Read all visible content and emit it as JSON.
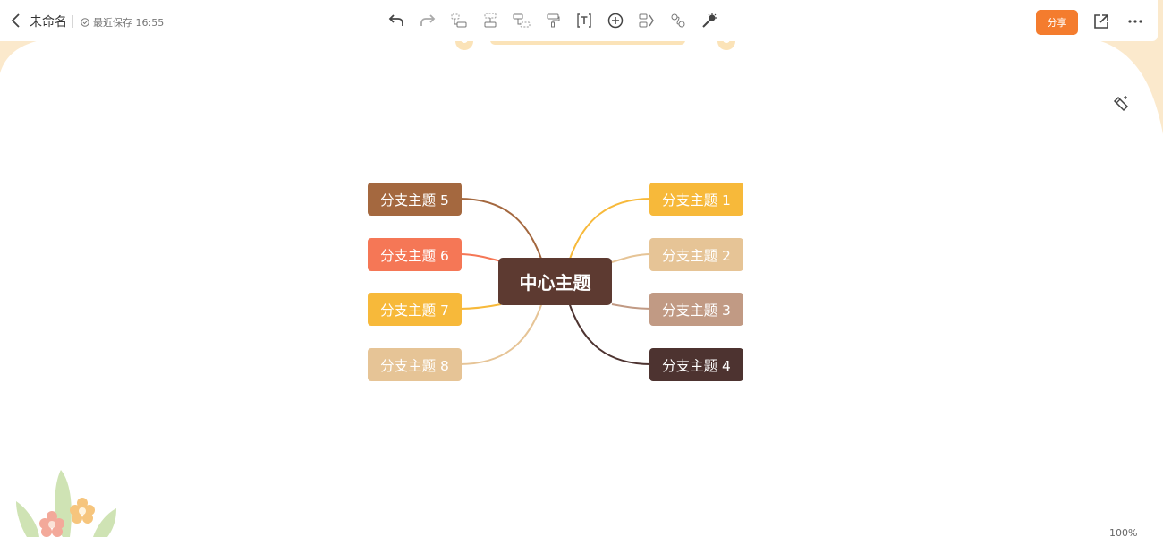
{
  "header": {
    "back_icon": "chevron-left-icon",
    "title": "未命名",
    "save_status": "最近保存 16:55",
    "share_label": "分享",
    "share_color": "#f47c2e"
  },
  "toolbar": {
    "items": [
      {
        "icon": "undo-icon"
      },
      {
        "icon": "redo-icon"
      },
      {
        "icon": "add-child-topic-icon"
      },
      {
        "icon": "add-sibling-topic-icon"
      },
      {
        "icon": "add-parent-topic-icon"
      },
      {
        "icon": "format-painter-icon"
      },
      {
        "icon": "text-icon"
      },
      {
        "icon": "insert-plus-icon"
      },
      {
        "icon": "summary-icon"
      },
      {
        "icon": "relationship-icon"
      },
      {
        "icon": "magic-wand-icon"
      }
    ]
  },
  "side_tools": {
    "format_icon": "style-brush-icon"
  },
  "mindmap": {
    "center": {
      "label": "中心主题",
      "color": "#5d3a31"
    },
    "branches": [
      {
        "label": "分支主题 1",
        "color": "#f7b93a"
      },
      {
        "label": "分支主题 2",
        "color": "#e6c496"
      },
      {
        "label": "分支主题 3",
        "color": "#c19a84"
      },
      {
        "label": "分支主题 4",
        "color": "#4d3330"
      },
      {
        "label": "分支主题 5",
        "color": "#a4683f"
      },
      {
        "label": "分支主题 6",
        "color": "#f57756"
      },
      {
        "label": "分支主题 7",
        "color": "#f7b93a"
      },
      {
        "label": "分支主题 8",
        "color": "#e6c496"
      }
    ]
  },
  "zoom_level": "100%"
}
